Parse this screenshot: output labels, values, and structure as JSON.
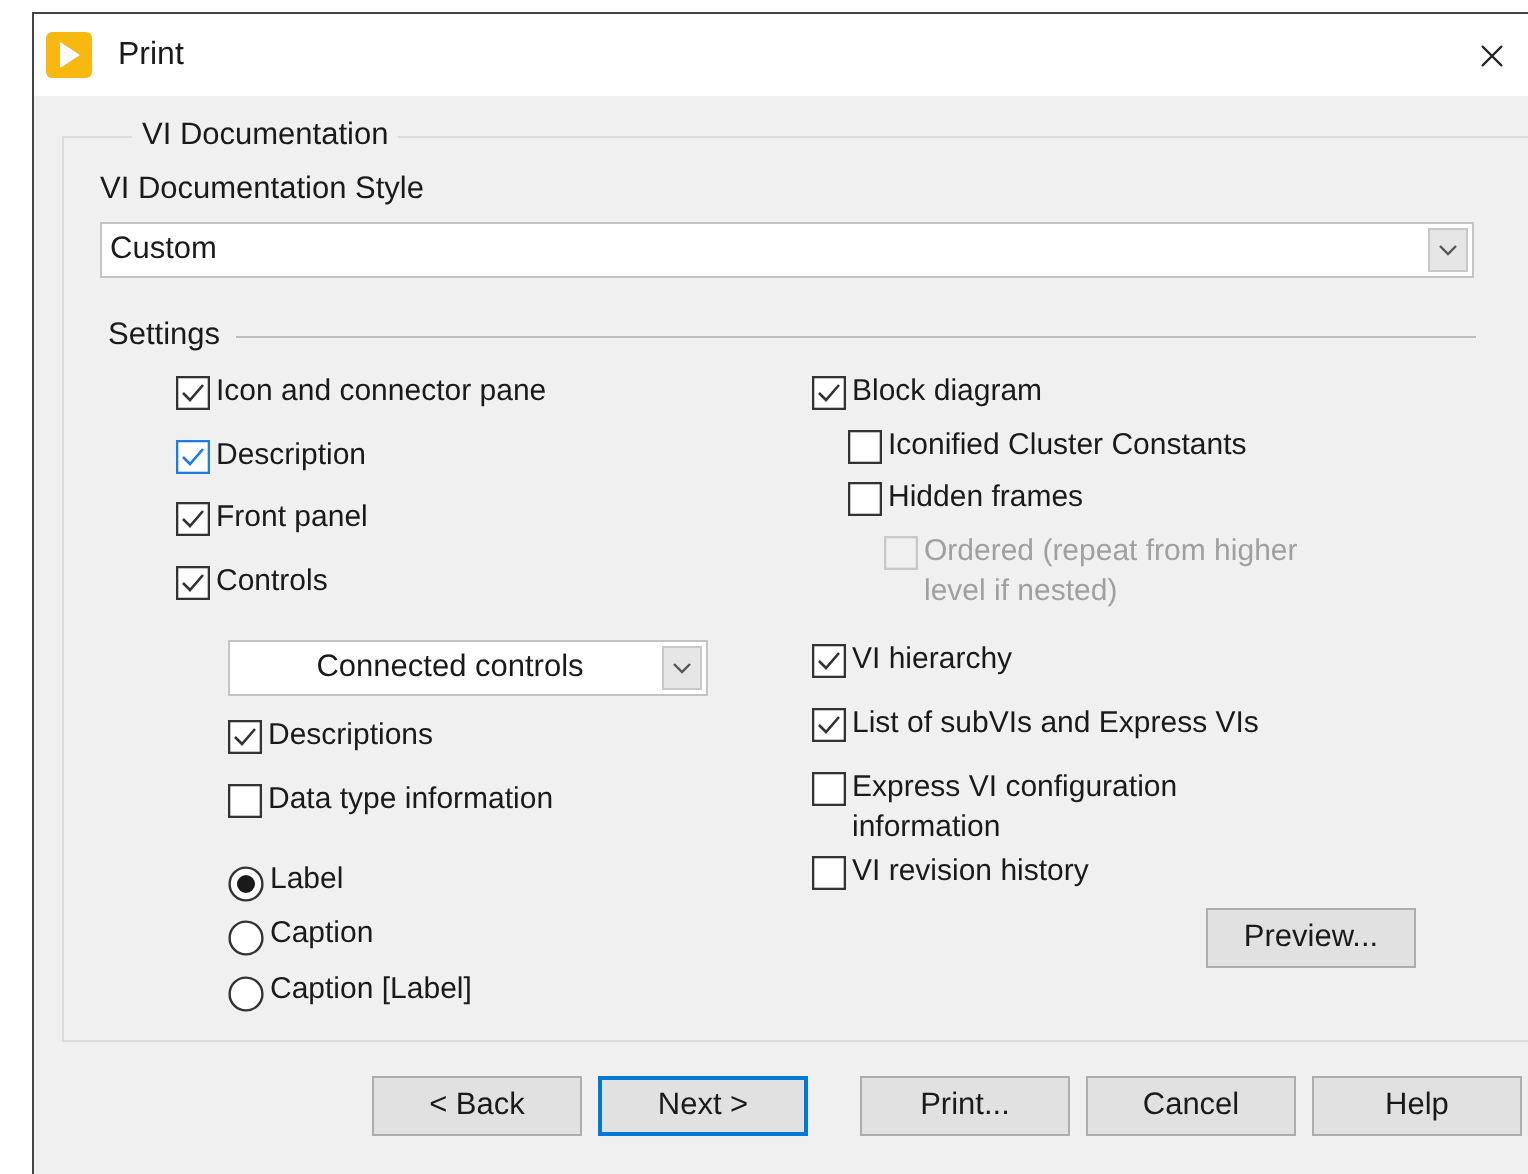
{
  "window": {
    "title": "Print"
  },
  "group": {
    "title": "VI Documentation",
    "style_label": "VI Documentation Style",
    "style_value": "Custom",
    "settings_label": "Settings"
  },
  "left_options": [
    {
      "label": "Icon and connector pane",
      "checked": true,
      "hovered": false
    },
    {
      "label": "Description",
      "checked": true,
      "hovered": true
    },
    {
      "label": "Front panel",
      "checked": true,
      "hovered": false
    },
    {
      "label": "Controls",
      "checked": true,
      "hovered": false
    }
  ],
  "controls_dropdown": {
    "value": "Connected controls"
  },
  "control_options": [
    {
      "label": "Descriptions",
      "checked": true
    },
    {
      "label": "Data type information",
      "checked": false
    }
  ],
  "label_radios": [
    {
      "label": "Label",
      "selected": true
    },
    {
      "label": "Caption",
      "selected": false
    },
    {
      "label": "Caption [Label]",
      "selected": false
    }
  ],
  "diagram_options": [
    {
      "label": "Block diagram",
      "checked": true,
      "disabled": false,
      "children": [
        {
          "label": "Iconified Cluster Constants",
          "checked": false,
          "disabled": false
        },
        {
          "label": "Hidden frames",
          "checked": false,
          "disabled": false,
          "children": [
            {
              "label": "Ordered (repeat from higher level if nested)",
              "checked": false,
              "disabled": true
            }
          ]
        }
      ]
    }
  ],
  "other_options": [
    {
      "label": "VI hierarchy",
      "checked": true
    },
    {
      "label": "List of subVIs and Express VIs",
      "checked": true
    },
    {
      "label": "Express VI configuration information",
      "checked": false
    },
    {
      "label": "VI revision history",
      "checked": false
    }
  ],
  "preview_button": {
    "label": "Preview..."
  },
  "buttons": [
    {
      "label": "< Back",
      "default": false
    },
    {
      "label": "Next >",
      "default": true
    },
    {
      "label": "Print...",
      "default": false
    },
    {
      "label": "Cancel",
      "default": false
    },
    {
      "label": "Help",
      "default": false
    }
  ]
}
